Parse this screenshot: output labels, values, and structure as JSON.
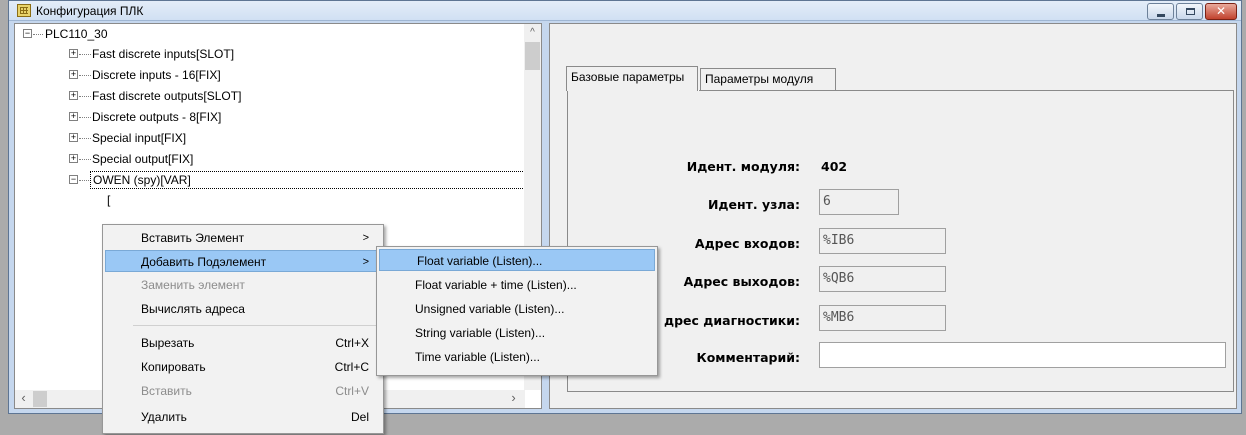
{
  "window": {
    "title": "Конфигурация ПЛК"
  },
  "tree": {
    "root": "PLC110_30",
    "items": [
      "Fast discrete inputs[SLOT]",
      "Discrete inputs - 16[FIX]",
      "Fast discrete outputs[SLOT]",
      "Discrete outputs - 8[FIX]",
      "Special input[FIX]",
      "Special output[FIX]",
      "OWEN (spy)[VAR]"
    ]
  },
  "tabs": [
    "Базовые параметры",
    "Параметры модуля"
  ],
  "form": {
    "module_id_label": "Идент. модуля:",
    "module_id_value": "402",
    "node_id_label": "Идент. узла:",
    "node_id_value": "6",
    "inputs_label": "Адрес входов:",
    "inputs_value": "%IB6",
    "outputs_label": "Адрес выходов:",
    "outputs_value": "%QB6",
    "diag_label": "дрес диагностики:",
    "diag_value": "%MB6",
    "comment_label": "Комментарий:",
    "comment_value": ""
  },
  "context_menu": {
    "items": [
      {
        "label": "Вставить Элемент",
        "shortcut": "",
        "submenu": true,
        "disabled": false
      },
      {
        "label": "Добавить Подэлемент",
        "shortcut": "",
        "submenu": true,
        "disabled": false
      },
      {
        "label": "Заменить элемент",
        "shortcut": "",
        "submenu": false,
        "disabled": true
      },
      {
        "label": "Вычислять адреса",
        "shortcut": "",
        "submenu": false,
        "disabled": false
      },
      {
        "label": "Вырезать",
        "shortcut": "Ctrl+X",
        "submenu": false,
        "disabled": false
      },
      {
        "label": "Копировать",
        "shortcut": "Ctrl+C",
        "submenu": false,
        "disabled": false
      },
      {
        "label": "Вставить",
        "shortcut": "Ctrl+V",
        "submenu": false,
        "disabled": true
      },
      {
        "label": "Удалить",
        "shortcut": "Del",
        "submenu": false,
        "disabled": false
      }
    ],
    "submenu_arrow": ">"
  },
  "submenu": {
    "items": [
      "Float variable (Listen)...",
      "Float variable + time (Listen)...",
      "Unsigned variable (Listen)...",
      "String variable (Listen)...",
      "Time variable (Listen)..."
    ]
  },
  "colors": {
    "highlight": "#9ac8f5",
    "frame": "#c5d7ee"
  }
}
